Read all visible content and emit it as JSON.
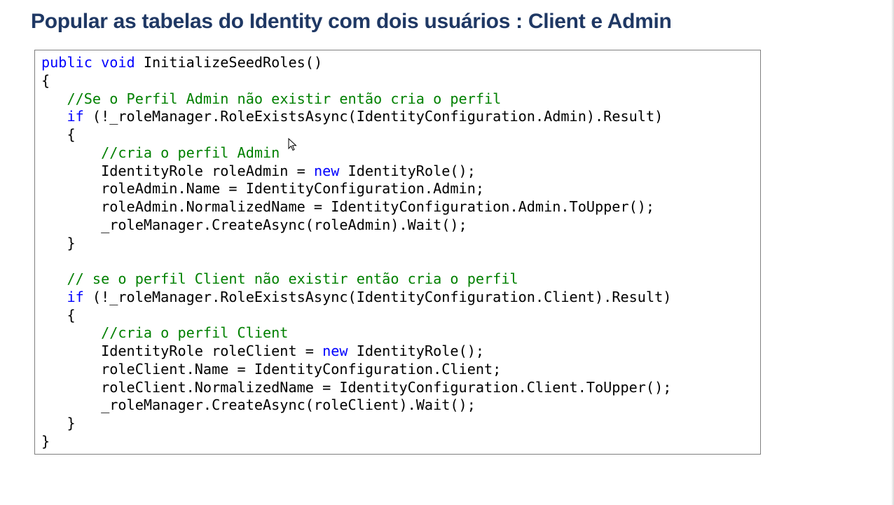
{
  "slide": {
    "title": "Popular as tabelas do Identity com dois usuários : Client e Admin"
  },
  "code": [
    [
      {
        "t": "kw",
        "v": "public"
      },
      {
        "t": "p",
        "v": " "
      },
      {
        "t": "kw",
        "v": "void"
      },
      {
        "t": "p",
        "v": " InitializeSeedRoles()"
      }
    ],
    [
      {
        "t": "p",
        "v": "{"
      }
    ],
    [
      {
        "t": "p",
        "v": "   "
      },
      {
        "t": "cm",
        "v": "//Se o Perfil Admin não existir então cria o perfil"
      }
    ],
    [
      {
        "t": "p",
        "v": "   "
      },
      {
        "t": "kw",
        "v": "if"
      },
      {
        "t": "p",
        "v": " (!_roleManager.RoleExistsAsync(IdentityConfiguration.Admin).Result)"
      }
    ],
    [
      {
        "t": "p",
        "v": "   {"
      }
    ],
    [
      {
        "t": "p",
        "v": "       "
      },
      {
        "t": "cm",
        "v": "//cria o perfil Admin"
      }
    ],
    [
      {
        "t": "p",
        "v": "       IdentityRole roleAdmin = "
      },
      {
        "t": "kw",
        "v": "new"
      },
      {
        "t": "p",
        "v": " IdentityRole();"
      }
    ],
    [
      {
        "t": "p",
        "v": "       roleAdmin.Name = IdentityConfiguration.Admin;"
      }
    ],
    [
      {
        "t": "p",
        "v": "       roleAdmin.NormalizedName = IdentityConfiguration.Admin.ToUpper();"
      }
    ],
    [
      {
        "t": "p",
        "v": "       _roleManager.CreateAsync(roleAdmin).Wait();"
      }
    ],
    [
      {
        "t": "p",
        "v": "   }"
      }
    ],
    [
      {
        "t": "p",
        "v": ""
      }
    ],
    [
      {
        "t": "p",
        "v": "   "
      },
      {
        "t": "cm",
        "v": "// se o perfil Client não existir então cria o perfil"
      }
    ],
    [
      {
        "t": "p",
        "v": "   "
      },
      {
        "t": "kw",
        "v": "if"
      },
      {
        "t": "p",
        "v": " (!_roleManager.RoleExistsAsync(IdentityConfiguration.Client).Result)"
      }
    ],
    [
      {
        "t": "p",
        "v": "   {"
      }
    ],
    [
      {
        "t": "p",
        "v": "       "
      },
      {
        "t": "cm",
        "v": "//cria o perfil Client"
      }
    ],
    [
      {
        "t": "p",
        "v": "       IdentityRole roleClient = "
      },
      {
        "t": "kw",
        "v": "new"
      },
      {
        "t": "p",
        "v": " IdentityRole();"
      }
    ],
    [
      {
        "t": "p",
        "v": "       roleClient.Name = IdentityConfiguration.Client;"
      }
    ],
    [
      {
        "t": "p",
        "v": "       roleClient.NormalizedName = IdentityConfiguration.Client.ToUpper();"
      }
    ],
    [
      {
        "t": "p",
        "v": "       _roleManager.CreateAsync(roleClient).Wait();"
      }
    ],
    [
      {
        "t": "p",
        "v": "   }"
      }
    ],
    [
      {
        "t": "p",
        "v": "}"
      }
    ]
  ],
  "colors": {
    "title": "#1f3864",
    "keyword": "#0000ff",
    "comment": "#008000",
    "plain": "#000000"
  },
  "icons": {
    "cursor": "mouse-pointer-icon"
  }
}
